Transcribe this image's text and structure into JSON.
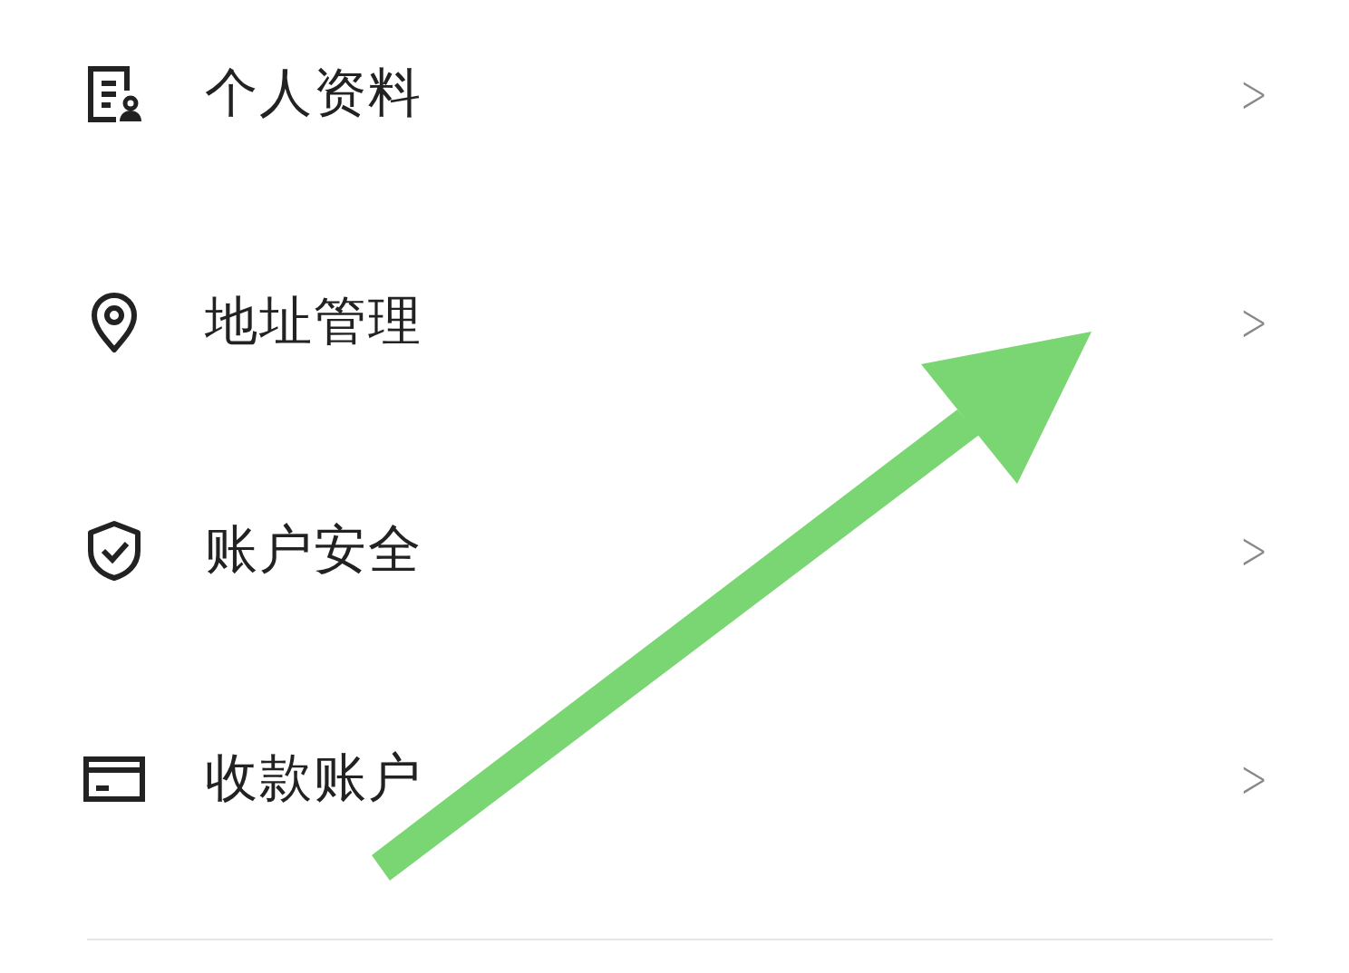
{
  "menu": [
    {
      "kind": "profile",
      "label": "个人资料",
      "chevron": ">"
    },
    {
      "kind": "address",
      "label": "地址管理",
      "chevron": ">"
    },
    {
      "kind": "security",
      "label": "账户安全",
      "chevron": ">"
    },
    {
      "kind": "payment",
      "label": "收款账户",
      "chevron": ">"
    }
  ]
}
